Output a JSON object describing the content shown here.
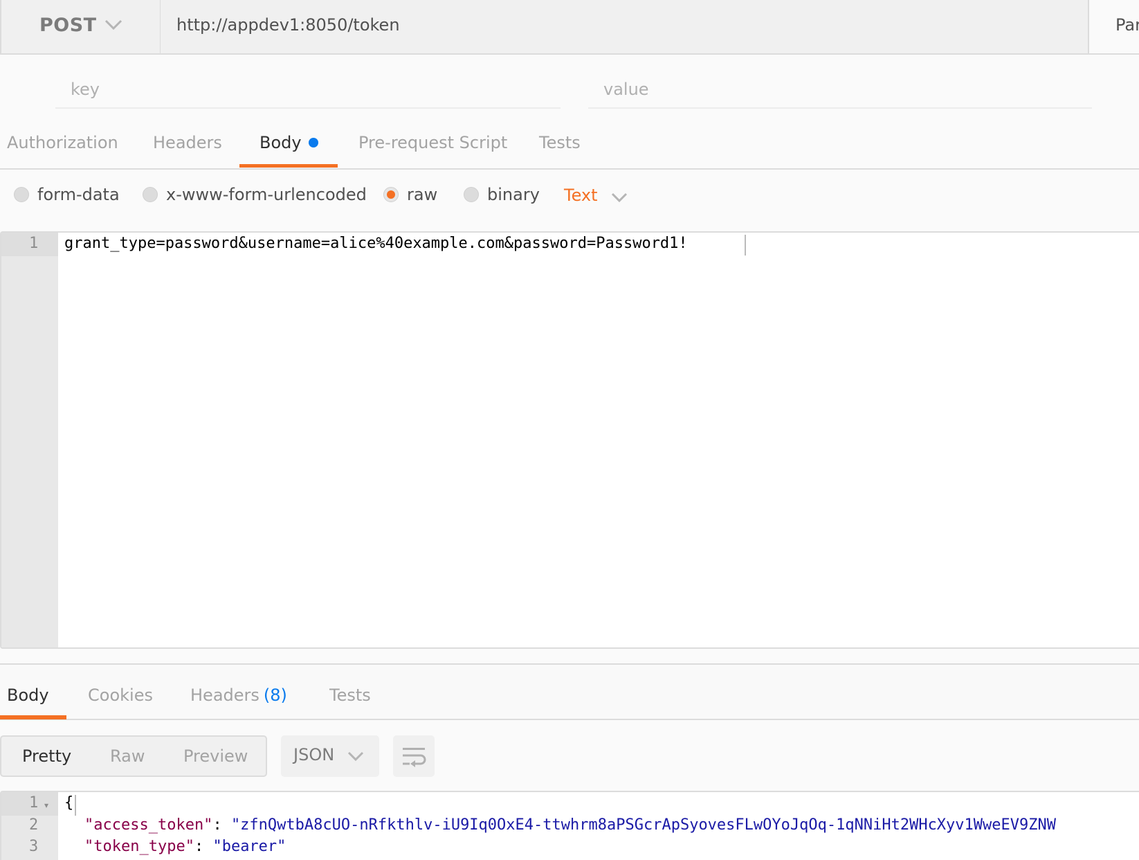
{
  "request": {
    "method": "POST",
    "url": "http://appdev1:8050/token",
    "params_label": "Params",
    "kv_placeholders": {
      "key": "key",
      "value": "value"
    },
    "tabs": [
      {
        "label": "Authorization",
        "active": false
      },
      {
        "label": "Headers",
        "active": false
      },
      {
        "label": "Body",
        "active": true,
        "indicator": "dot"
      },
      {
        "label": "Pre-request Script",
        "active": false
      },
      {
        "label": "Tests",
        "active": false
      }
    ],
    "body_types": [
      {
        "label": "form-data",
        "checked": false
      },
      {
        "label": "x-www-form-urlencoded",
        "checked": false
      },
      {
        "label": "raw",
        "checked": true
      },
      {
        "label": "binary",
        "checked": false
      }
    ],
    "raw_format": "Text",
    "editor": {
      "lines": [
        {
          "num": "1",
          "text": "grant_type=password&username=alice%40example.com&password=Password1!"
        }
      ]
    }
  },
  "response": {
    "tabs": [
      {
        "label": "Body",
        "active": true
      },
      {
        "label": "Cookies",
        "active": false
      },
      {
        "label": "Headers",
        "count": "(8)",
        "active": false
      },
      {
        "label": "Tests",
        "active": false
      }
    ],
    "view_modes": [
      {
        "label": "Pretty",
        "active": true
      },
      {
        "label": "Raw",
        "active": false
      },
      {
        "label": "Preview",
        "active": false
      }
    ],
    "language": "JSON",
    "wrap_icon": "wrap-lines-icon",
    "editor": {
      "lines": [
        {
          "num": "1",
          "text": "{"
        },
        {
          "num": "2",
          "key": "\"access_token\"",
          "sep": ": ",
          "value": "\"zfnQwtbA8cUO-nRfkthlv-iU9Iq0OxE4-ttwhrm8aPSGcrApSyovesFLwOYoJqOq-1qNNiHt2WHcXyv1WweEV9ZNW"
        },
        {
          "num": "3",
          "key": "\"token_type\"",
          "sep": ": ",
          "value": "\"bearer\""
        }
      ]
    }
  },
  "colors": {
    "accent": "#f47023",
    "link_blue": "#0a7bed",
    "json_key": "#880049",
    "json_string": "#1a1aa6"
  }
}
